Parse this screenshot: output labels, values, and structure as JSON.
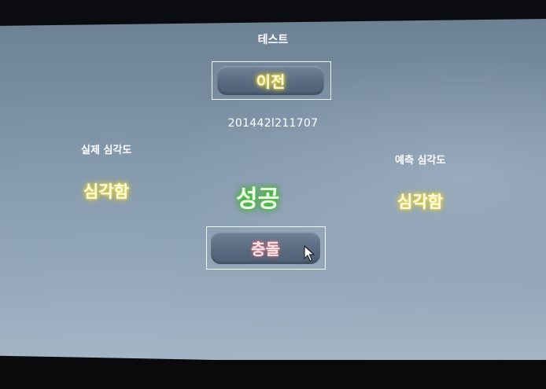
{
  "screen": {
    "title": "테스트"
  },
  "buttons": {
    "prev_label": "이전",
    "crash_label": "충돌"
  },
  "record_id": "201442l211707",
  "actual": {
    "label": "실제 심각도",
    "value": "심각함"
  },
  "predicted": {
    "label": "예측 심각도",
    "value": "심각함"
  },
  "result": "성공",
  "colors": {
    "screen_background": "#7f93a7",
    "severity_glow": "#e2d244",
    "result_glow": "#3fb62c",
    "crash_glow": "#c55d6c"
  },
  "icons": {
    "cursor": "mouse-pointer-icon"
  }
}
